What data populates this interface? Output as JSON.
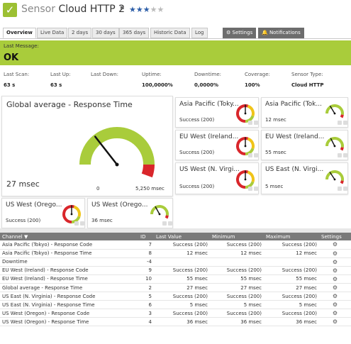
{
  "header": {
    "check": "✓",
    "title_prefix": "Sensor",
    "title_name": "Cloud HTTP 2",
    "pin": "⚑",
    "stars_filled": "★★★",
    "stars_empty": "★★",
    "priority": 3
  },
  "tabs": [
    {
      "label": "Overview"
    },
    {
      "label": "Live Data"
    },
    {
      "label": "2 days"
    },
    {
      "label": "30 days"
    },
    {
      "label": "365 days"
    },
    {
      "label": "Historic Data"
    },
    {
      "label": "Log"
    },
    {
      "label": "⚙ Settings"
    },
    {
      "label": "🔔 Notifications"
    }
  ],
  "status": {
    "label": "Last Message:",
    "value": "OK"
  },
  "stats": [
    {
      "key": "Last Scan:",
      "value": "63 s"
    },
    {
      "key": "Last Up:",
      "value": "63 s"
    },
    {
      "key": "Last Down:",
      "value": ""
    },
    {
      "key": "Uptime:",
      "value": "100,0000%"
    },
    {
      "key": "Downtime:",
      "value": "0,0000%"
    },
    {
      "key": "Coverage:",
      "value": "100%"
    },
    {
      "key": "Sensor Type:",
      "value": "Cloud HTTP"
    }
  ],
  "colors": {
    "accent": "#a9cc3b",
    "gauge_green": "#a9cc3b",
    "gauge_yellow": "#f0c419",
    "gauge_red": "#d9262b",
    "header_gray": "#7a7a7a"
  },
  "big_gauge": {
    "name": "Global average - Response Time",
    "value": "27 msec",
    "min": "0",
    "max": "5,250 msec",
    "level": 0.26
  },
  "gauges": [
    {
      "name": "Asia Pacific (Toky...",
      "value": "Success (200)",
      "type": "code",
      "level": 0.45
    },
    {
      "name": "Asia Pacific (Tok...",
      "value": "12 msec",
      "type": "time",
      "level": 0.28
    },
    {
      "name": "EU West (Ireland...",
      "value": "Success (200)",
      "type": "code",
      "level": 0.45
    },
    {
      "name": "EU West (Ireland...",
      "value": "55 msec",
      "type": "time",
      "level": 0.3
    },
    {
      "name": "US West (N. Virgi...",
      "value": "Success (200)",
      "type": "code",
      "level": 0.45
    },
    {
      "name": "US East (N. Virgi...",
      "value": "5 msec",
      "type": "time",
      "level": 0.27
    },
    {
      "name": "US West (Orego...",
      "value": "Success (200)",
      "type": "code",
      "level": 0.45
    },
    {
      "name": "US West (Orego...",
      "value": "36 msec",
      "type": "time",
      "level": 0.29
    }
  ],
  "table": {
    "headers": {
      "channel": "Channel ▼",
      "id": "ID",
      "last": "Last Value",
      "min": "Minimum",
      "max": "Maximum",
      "settings": "Settings"
    },
    "rows": [
      {
        "channel": "Asia Pacific (Tokyo) - Response Code",
        "id": "7",
        "last": "Success (200)",
        "min": "Success (200)",
        "max": "Success (200)",
        "settings": "⚙"
      },
      {
        "channel": "Asia Pacific (Tokyo) - Response Time",
        "id": "8",
        "last": "12 msec",
        "min": "12 msec",
        "max": "12 msec",
        "settings": "⚙"
      },
      {
        "channel": "Downtime",
        "id": "-4",
        "last": "",
        "min": "",
        "max": "",
        "settings": "⚙"
      },
      {
        "channel": "EU West (Ireland) - Response Code",
        "id": "9",
        "last": "Success (200)",
        "min": "Success (200)",
        "max": "Success (200)",
        "settings": "⚙"
      },
      {
        "channel": "EU West (Ireland) - Response Time",
        "id": "10",
        "last": "55 msec",
        "min": "55 msec",
        "max": "55 msec",
        "settings": "⚙"
      },
      {
        "channel": "Global average - Response Time",
        "id": "2",
        "last": "27 msec",
        "min": "27 msec",
        "max": "27 msec",
        "settings": "⚙"
      },
      {
        "channel": "US East (N. Virginia) - Response Code",
        "id": "5",
        "last": "Success (200)",
        "min": "Success (200)",
        "max": "Success (200)",
        "settings": "⚙"
      },
      {
        "channel": "US East (N. Virginia) - Response Time",
        "id": "6",
        "last": "5 msec",
        "min": "5 msec",
        "max": "5 msec",
        "settings": "⚙"
      },
      {
        "channel": "US West (Oregon) - Response Code",
        "id": "3",
        "last": "Success (200)",
        "min": "Success (200)",
        "max": "Success (200)",
        "settings": "⚙"
      },
      {
        "channel": "US West (Oregon) - Response Time",
        "id": "4",
        "last": "36 msec",
        "min": "36 msec",
        "max": "36 msec",
        "settings": "⚙"
      }
    ]
  }
}
